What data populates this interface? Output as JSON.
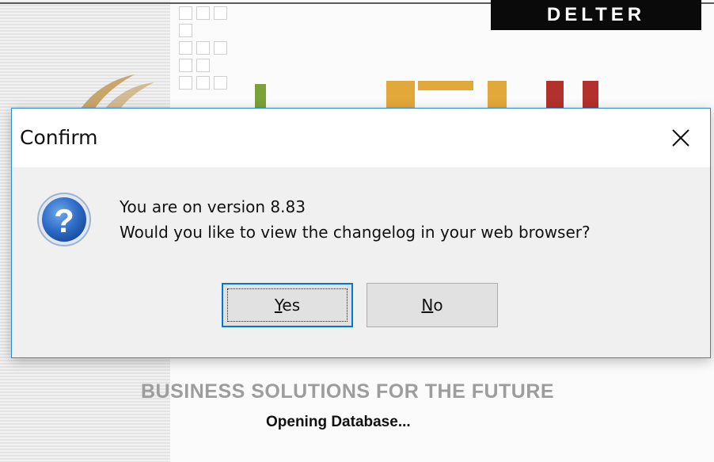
{
  "splash": {
    "brand": "DELTER",
    "tagline": "BUSINESS SOLUTIONS FOR THE FUTURE",
    "status": "Opening Database...",
    "colors": {
      "logo_swoosh": "#c8a56b",
      "logo_green": "#7aa13a",
      "logo_gold": "#e2a83a",
      "logo_red": "#b2312c"
    }
  },
  "dialog": {
    "title": "Confirm",
    "close_icon": "close-x-icon",
    "message_icon": "question-icon",
    "message": {
      "line1": "You are on version 8.83",
      "line2": "Would you like to view the changelog in your web browser?"
    },
    "buttons": {
      "yes": {
        "mnemonic": "Y",
        "rest": "es"
      },
      "no": {
        "mnemonic": "N",
        "rest": "o"
      }
    },
    "accent": "#0078d7"
  }
}
